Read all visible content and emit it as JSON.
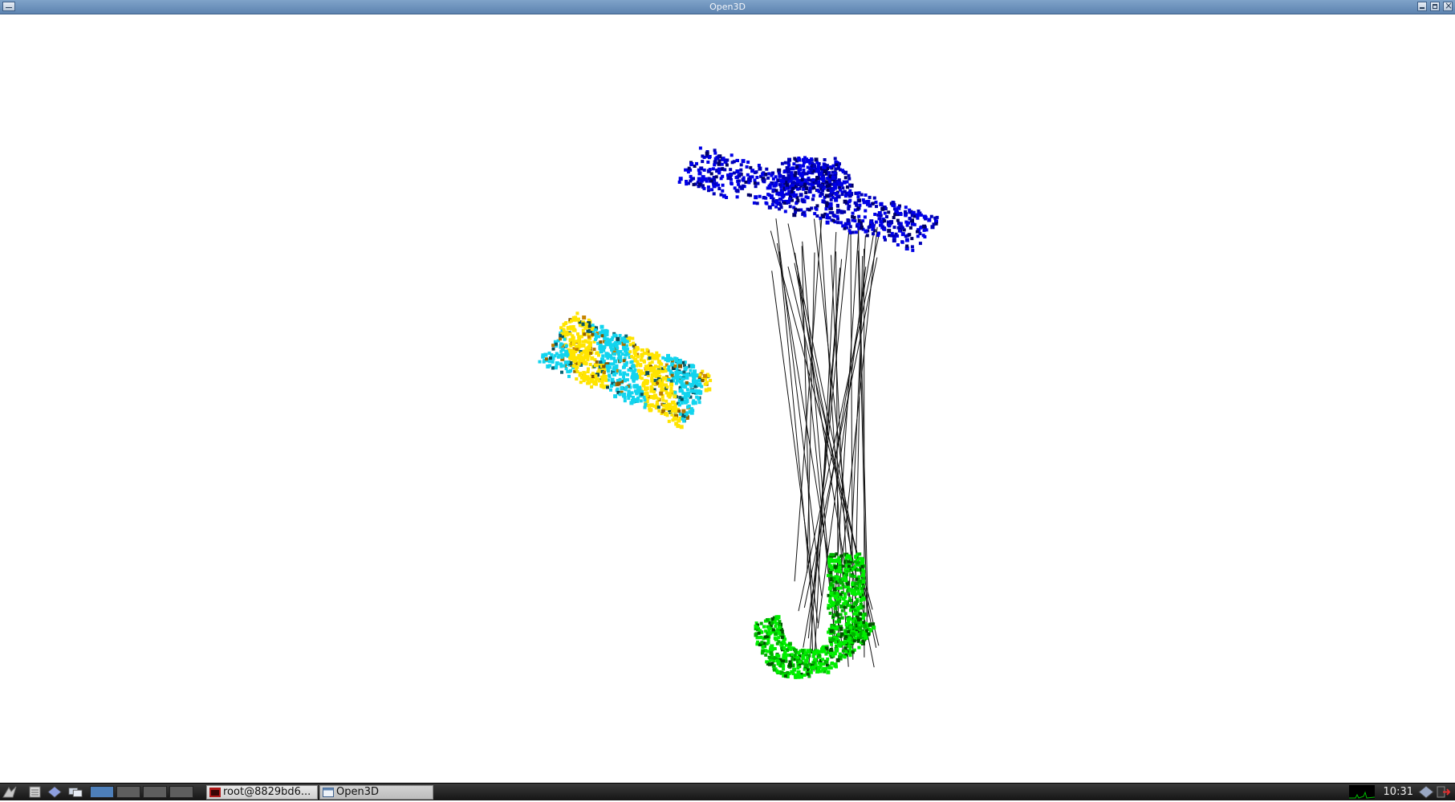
{
  "window": {
    "title": "Open3D"
  },
  "taskbar": {
    "tasks": [
      {
        "label": "root@8829bd6...",
        "icon": "terminal-icon"
      },
      {
        "label": "Open3D",
        "icon": "window-icon"
      }
    ],
    "clock": "10:31",
    "active_desktop": 1
  },
  "colors": {
    "source_cloud": "#0000e6",
    "target_cloud": "#00ee00",
    "aligned_cyan": "#12d4ee",
    "aligned_yellow": "#ffe400",
    "correspondence_lines": "#111111"
  }
}
